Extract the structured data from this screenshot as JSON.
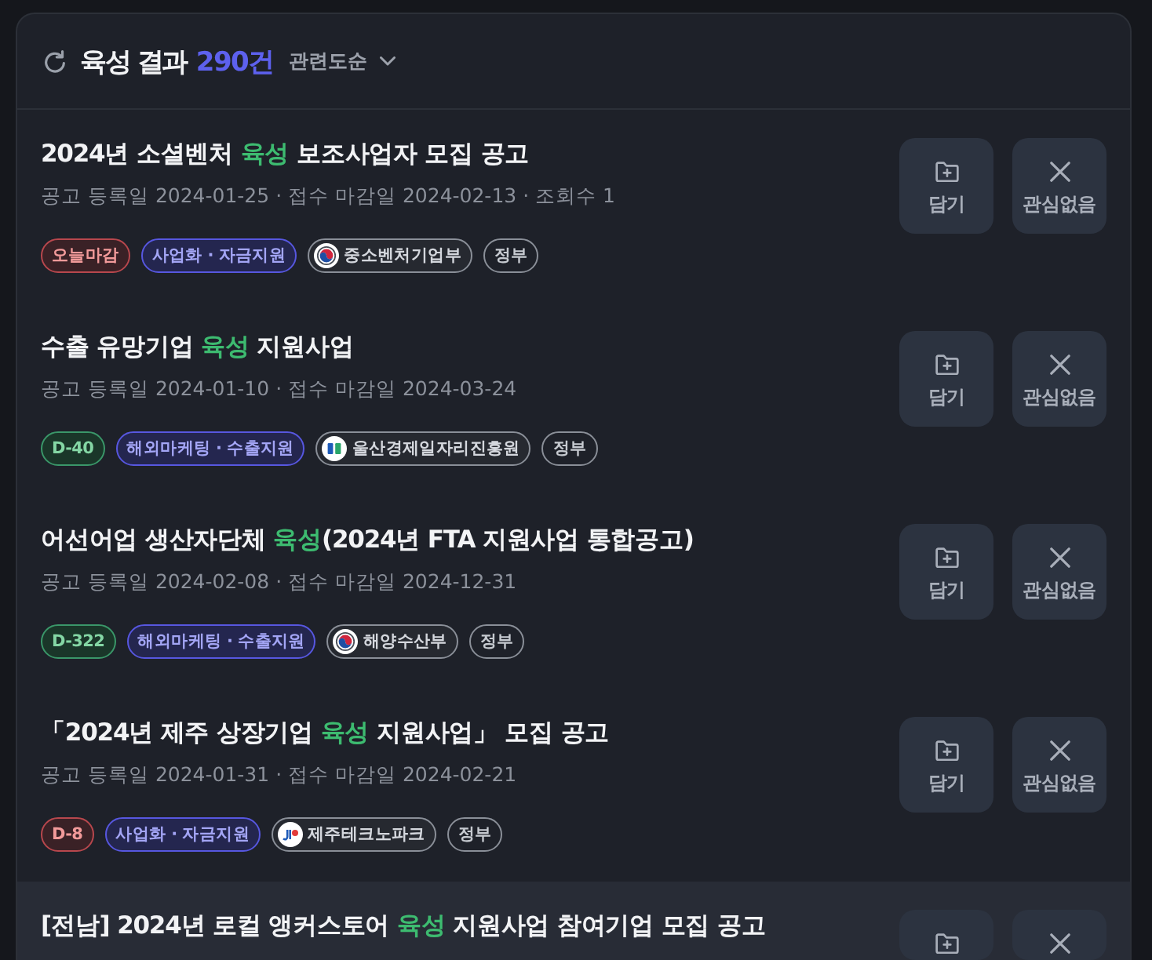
{
  "header": {
    "title": "육성 결과",
    "count": "290건",
    "sort": {
      "label": "관련도순"
    }
  },
  "results": [
    {
      "title": [
        {
          "text": "2024년 소셜벤처 ",
          "highlight": false
        },
        {
          "text": "육성",
          "highlight": true
        },
        {
          "text": " 보조사업자 모집 공고",
          "highlight": false
        }
      ],
      "meta": "공고 등록일 2024-01-25 · 접수 마감일 2024-02-13 · 조회수 1",
      "tags": [
        {
          "kind": "deadline",
          "text": "오늘마감",
          "urgent": true
        },
        {
          "kind": "category",
          "text": "사업화 · 자금지원"
        },
        {
          "kind": "agency",
          "text": "중소벤처기업부",
          "logo": {
            "kind": "emblem"
          }
        },
        {
          "kind": "type",
          "text": "정부"
        }
      ],
      "actions": [
        {
          "kind": "save",
          "label": "담기"
        },
        {
          "kind": "dismiss",
          "label": "관심없음"
        }
      ],
      "hovered": false
    },
    {
      "title": [
        {
          "text": "수출 유망기업 ",
          "highlight": false
        },
        {
          "text": "육성",
          "highlight": true
        },
        {
          "text": " 지원사업",
          "highlight": false
        }
      ],
      "meta": "공고 등록일 2024-01-10 · 접수 마감일 2024-03-24",
      "tags": [
        {
          "kind": "deadline",
          "text": "D-40",
          "urgent": false
        },
        {
          "kind": "category",
          "text": "해외마케팅 · 수출지원"
        },
        {
          "kind": "agency",
          "text": "울산경제일자리진흥원",
          "logo": {
            "kind": "square"
          }
        },
        {
          "kind": "type",
          "text": "정부"
        }
      ],
      "actions": [
        {
          "kind": "save",
          "label": "담기"
        },
        {
          "kind": "dismiss",
          "label": "관심없음"
        }
      ],
      "hovered": false
    },
    {
      "title": [
        {
          "text": "어선어업 생산자단체 ",
          "highlight": false
        },
        {
          "text": "육성",
          "highlight": true
        },
        {
          "text": "(2024년 FTA 지원사업 통합공고)",
          "highlight": false
        }
      ],
      "meta": "공고 등록일 2024-02-08 · 접수 마감일 2024-12-31",
      "tags": [
        {
          "kind": "deadline",
          "text": "D-322",
          "urgent": false
        },
        {
          "kind": "category",
          "text": "해외마케팅 · 수출지원"
        },
        {
          "kind": "agency",
          "text": "해양수산부",
          "logo": {
            "kind": "emblem"
          }
        },
        {
          "kind": "type",
          "text": "정부"
        }
      ],
      "actions": [
        {
          "kind": "save",
          "label": "담기"
        },
        {
          "kind": "dismiss",
          "label": "관심없음"
        }
      ],
      "hovered": false
    },
    {
      "title": [
        {
          "text": "「2024년 제주 상장기업 ",
          "highlight": false
        },
        {
          "text": "육성",
          "highlight": true
        },
        {
          "text": " 지원사업」 모집 공고",
          "highlight": false
        }
      ],
      "meta": "공고 등록일 2024-01-31 · 접수 마감일 2024-02-21",
      "tags": [
        {
          "kind": "deadline",
          "text": "D-8",
          "urgent": true
        },
        {
          "kind": "category",
          "text": "사업화 · 자금지원"
        },
        {
          "kind": "agency",
          "text": "제주테크노파크",
          "logo": {
            "kind": "mark"
          }
        },
        {
          "kind": "type",
          "text": "정부"
        }
      ],
      "actions": [
        {
          "kind": "save",
          "label": "담기"
        },
        {
          "kind": "dismiss",
          "label": "관심없음"
        }
      ],
      "hovered": false
    },
    {
      "title": [
        {
          "text": "[전남] 2024년 로컬 앵커스토어 ",
          "highlight": false
        },
        {
          "text": "육성",
          "highlight": true
        },
        {
          "text": " 지원사업 참여기업 모집 공고",
          "highlight": false
        }
      ],
      "actions": [
        {
          "kind": "save"
        },
        {
          "kind": "dismiss"
        }
      ],
      "hovered": true
    }
  ]
}
